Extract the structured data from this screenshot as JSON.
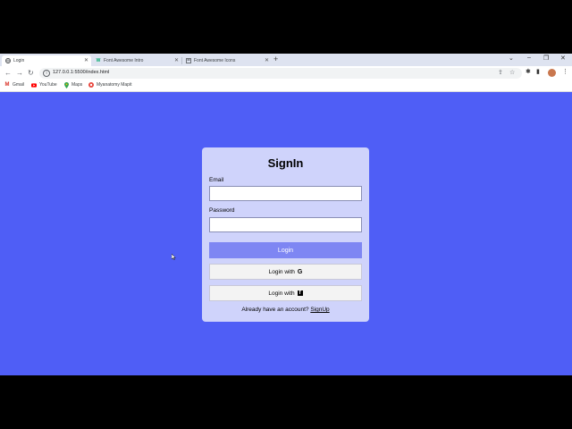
{
  "tabs": [
    {
      "title": "Login",
      "icon": "globe-icon",
      "active": true
    },
    {
      "title": "Font Awesome Intro",
      "icon": "w3-icon",
      "active": false
    },
    {
      "title": "Font Awesome Icons",
      "icon": "page-icon",
      "active": false
    }
  ],
  "address": {
    "url": "127.0.0.1:5500/index.html"
  },
  "bookmarks": [
    {
      "label": "Gmail",
      "icon": "gmail-icon",
      "color": "#d93025"
    },
    {
      "label": "YouTube",
      "icon": "youtube-icon",
      "color": "#ff0000"
    },
    {
      "label": "Maps",
      "icon": "maps-icon",
      "color": "#34a853"
    },
    {
      "label": "Myanatomy Mapit",
      "icon": "mapit-icon",
      "color": "#e8453c"
    }
  ],
  "login": {
    "title": "SignIn",
    "email_label": "Email",
    "email_value": "",
    "password_label": "Password",
    "password_value": "",
    "login_button": "Login",
    "google_button": "Login with",
    "google_icon": "G",
    "facebook_button": "Login with",
    "facebook_icon": "f",
    "footer_text": "Already have an account?",
    "signup_link": "SignUp"
  },
  "colors": {
    "page_background": "#4f5ef6",
    "card_background": "#cfd3fb",
    "primary_button": "#7e86f3"
  }
}
